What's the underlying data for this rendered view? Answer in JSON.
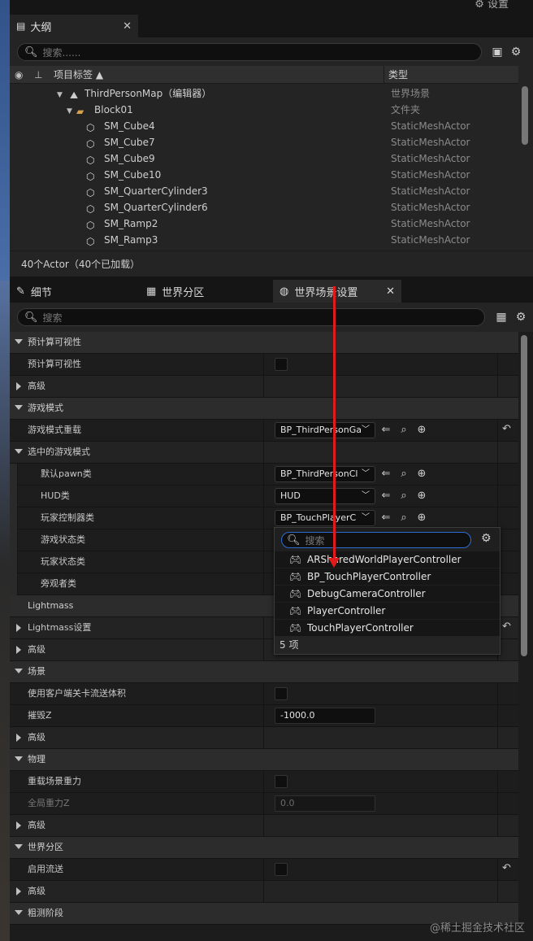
{
  "top": {
    "settings_label": "设置"
  },
  "outliner": {
    "tab_title": "大纲",
    "search_placeholder": "搜索......",
    "columns": {
      "label": "项目标签 ▲",
      "type": "类型"
    },
    "rows": [
      {
        "name": "ThirdPersonMap（编辑器）",
        "type": "世界场景",
        "indent": 1,
        "kind": "map"
      },
      {
        "name": "Block01",
        "type": "文件夹",
        "indent": 2,
        "kind": "folder"
      },
      {
        "name": "SM_Cube4",
        "type": "StaticMeshActor",
        "indent": 3,
        "kind": "mesh"
      },
      {
        "name": "SM_Cube7",
        "type": "StaticMeshActor",
        "indent": 3,
        "kind": "mesh"
      },
      {
        "name": "SM_Cube9",
        "type": "StaticMeshActor",
        "indent": 3,
        "kind": "mesh"
      },
      {
        "name": "SM_Cube10",
        "type": "StaticMeshActor",
        "indent": 3,
        "kind": "mesh"
      },
      {
        "name": "SM_QuarterCylinder3",
        "type": "StaticMeshActor",
        "indent": 3,
        "kind": "mesh"
      },
      {
        "name": "SM_QuarterCylinder6",
        "type": "StaticMeshActor",
        "indent": 3,
        "kind": "mesh"
      },
      {
        "name": "SM_Ramp2",
        "type": "StaticMeshActor",
        "indent": 3,
        "kind": "mesh"
      },
      {
        "name": "SM_Ramp3",
        "type": "StaticMeshActor",
        "indent": 3,
        "kind": "mesh"
      }
    ],
    "footer": "40个Actor（40个已加载）"
  },
  "details": {
    "tabs": [
      {
        "label": "细节"
      },
      {
        "label": "世界分区"
      },
      {
        "label": "世界场景设置"
      }
    ],
    "search_placeholder": "搜索",
    "rows": [
      {
        "label": "预计算可视性",
        "kind": "cat",
        "exp": "down"
      },
      {
        "label": "预计算可视性",
        "kind": "prop",
        "widget": "checkbox"
      },
      {
        "label": "高级",
        "kind": "sub",
        "exp": "right"
      },
      {
        "label": "游戏模式",
        "kind": "cat",
        "exp": "down"
      },
      {
        "label": "游戏模式重载",
        "kind": "prop",
        "widget": "combo",
        "value": "BP_ThirdPersonGa",
        "icons": true,
        "reset": true
      },
      {
        "label": "选中的游戏模式",
        "kind": "sub",
        "exp": "down"
      },
      {
        "label": "默认pawn类",
        "kind": "prop",
        "nested": true,
        "widget": "combo",
        "value": "BP_ThirdPersonCl",
        "icons": true
      },
      {
        "label": "HUD类",
        "kind": "prop",
        "nested": true,
        "widget": "combo",
        "value": "HUD",
        "icons": true
      },
      {
        "label": "玩家控制器类",
        "kind": "prop",
        "nested": true,
        "widget": "combo",
        "value": "BP_TouchPlayerC",
        "icons": true
      },
      {
        "label": "游戏状态类",
        "kind": "prop",
        "nested": true
      },
      {
        "label": "玩家状态类",
        "kind": "prop",
        "nested": true
      },
      {
        "label": "旁观者类",
        "kind": "prop",
        "nested": true
      },
      {
        "label": "Lightmass",
        "kind": "cat"
      },
      {
        "label": "Lightmass设置",
        "kind": "sub",
        "exp": "right",
        "reset": true
      },
      {
        "label": "高级",
        "kind": "sub",
        "exp": "right"
      },
      {
        "label": "场景",
        "kind": "cat",
        "exp": "down"
      },
      {
        "label": "使用客户端关卡流送体积",
        "kind": "prop",
        "widget": "checkbox"
      },
      {
        "label": "摧毁Z",
        "kind": "prop",
        "widget": "num",
        "value": "-1000.0"
      },
      {
        "label": "高级",
        "kind": "sub",
        "exp": "right"
      },
      {
        "label": "物理",
        "kind": "cat",
        "exp": "down"
      },
      {
        "label": "重载场景重力",
        "kind": "prop",
        "widget": "checkbox"
      },
      {
        "label": "全局重力Z",
        "kind": "prop",
        "widget": "num",
        "value": "0.0",
        "dim": true
      },
      {
        "label": "高级",
        "kind": "sub",
        "exp": "right"
      },
      {
        "label": "世界分区",
        "kind": "cat",
        "exp": "down"
      },
      {
        "label": "启用流送",
        "kind": "prop",
        "widget": "checkbox",
        "reset": true
      },
      {
        "label": "高级",
        "kind": "sub",
        "exp": "right"
      },
      {
        "label": "粗测阶段",
        "kind": "cat",
        "exp": "down"
      }
    ]
  },
  "popup": {
    "search_placeholder": "搜索",
    "items": [
      "ARSharedWorldPlayerController",
      "BP_TouchPlayerController",
      "DebugCameraController",
      "PlayerController",
      "TouchPlayerController"
    ],
    "footer": "5 项"
  },
  "watermark": "@稀土掘金技术社区",
  "colors": {
    "panel": "#242424",
    "accent": "#2b6dd2",
    "annotation": "#e01b1b"
  }
}
